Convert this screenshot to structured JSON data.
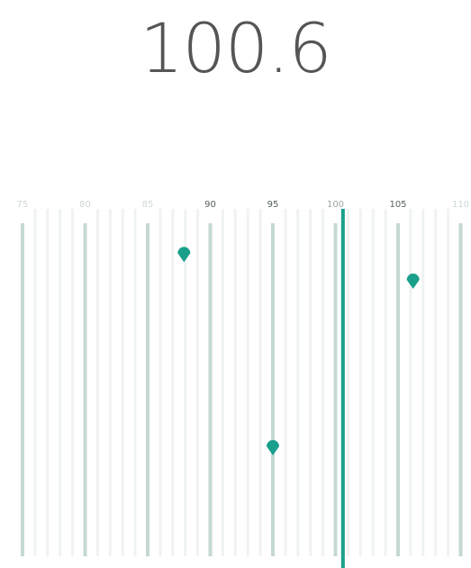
{
  "tuner": {
    "frequency": "100.6",
    "current_value": 100.6,
    "scale": {
      "min": 75,
      "max": 110,
      "major_step": 5,
      "minor_step": 1
    },
    "labels": [
      {
        "text": "75",
        "value": 75,
        "emphasis": "faint"
      },
      {
        "text": "80",
        "value": 80,
        "emphasis": "faint"
      },
      {
        "text": "85",
        "value": 85,
        "emphasis": "faint"
      },
      {
        "text": "90",
        "value": 90,
        "emphasis": "strong"
      },
      {
        "text": "95",
        "value": 95,
        "emphasis": "strong"
      },
      {
        "text": "100",
        "value": 100,
        "emphasis": "medium"
      },
      {
        "text": "105",
        "value": 105,
        "emphasis": "strong"
      },
      {
        "text": "110",
        "value": 110,
        "emphasis": "faint"
      }
    ],
    "stations": [
      {
        "value": 87.9,
        "level": 0.09
      },
      {
        "value": 95.0,
        "level": 0.67
      },
      {
        "value": 106.2,
        "level": 0.17
      }
    ],
    "colors": {
      "accent": "#1a9f8b",
      "major_tick": "#c5d9d3",
      "minor_tick": "#eff3f2",
      "label_faint": "#cfd8d5",
      "label_medium": "#9aa6a3",
      "label_strong": "#555f5c",
      "frequency_text": "#555555"
    }
  }
}
